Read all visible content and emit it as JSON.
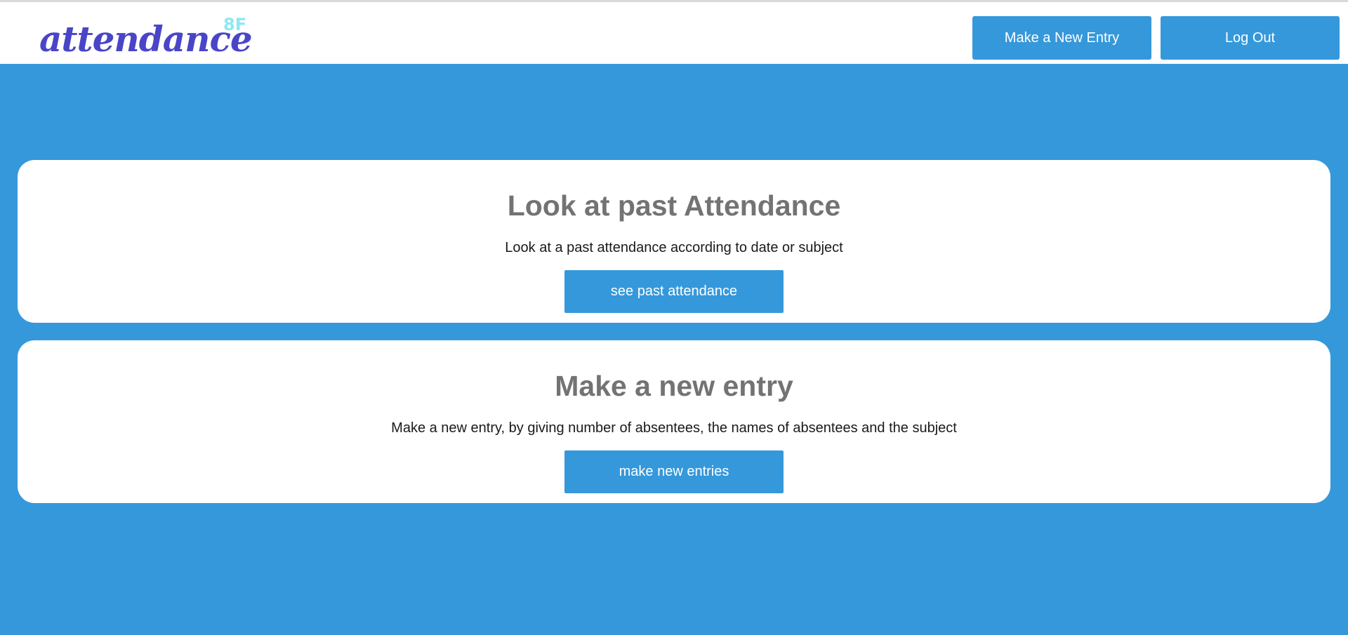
{
  "header": {
    "logo_text": "attendance",
    "logo_superscript": "8F",
    "new_entry_button": "Make a New Entry",
    "logout_button": "Log Out"
  },
  "cards": [
    {
      "title": "Look at past Attendance",
      "description": "Look at a past attendance according to date or subject",
      "button_label": "see past attendance"
    },
    {
      "title": "Make a new entry",
      "description": "Make a new entry, by giving number of absentees, the names of absentees and the subject",
      "button_label": "make new entries"
    }
  ],
  "colors": {
    "primary": "#3598db",
    "logo": "#4a45c7",
    "logo_superscript": "#8ee7f5",
    "card_title": "#737373"
  }
}
